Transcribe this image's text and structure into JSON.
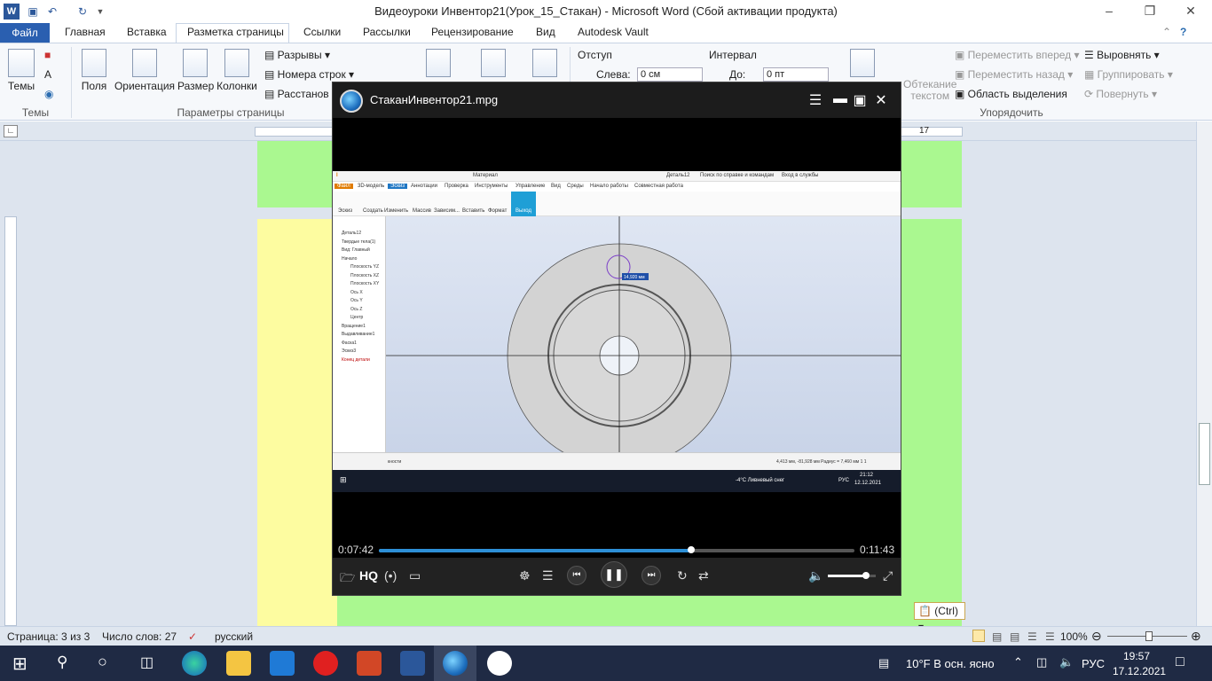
{
  "window": {
    "title": "Видеоуроки Инвентор21(Урок_15_Стакан)  -  Microsoft Word (Сбой активации продукта)"
  },
  "tabs": {
    "file": "Файл",
    "items": [
      "Главная",
      "Вставка",
      "Разметка страницы",
      "Ссылки",
      "Рассылки",
      "Рецензирование",
      "Вид",
      "Autodesk Vault"
    ]
  },
  "ribbon": {
    "themes": "Темы",
    "margins": "Поля",
    "orientation": "Ориентация",
    "size": "Размер",
    "columns": "Колонки",
    "breaks": "Разрывы",
    "line_numbers": "Номера строк",
    "hyphenation": "Расстанов",
    "group_themes": "Темы",
    "group_page_setup": "Параметры страницы",
    "indent_label": "Отступ",
    "indent_left_label": "Слева:",
    "indent_left_value": "0 см",
    "spacing_label": "Интервал",
    "spacing_after_label": "До:",
    "spacing_after_value": "0 пт",
    "wrap_text": "Обтекание",
    "wrap_text2": "текстом",
    "bring_forward": "Переместить вперед",
    "send_backward": "Переместить назад",
    "selection_pane": "Область выделения",
    "align": "Выровнять",
    "group": "Группировать",
    "rotate": "Повернуть",
    "group_arrange": "Упорядочить"
  },
  "ruler": {
    "right_mark": "17"
  },
  "player": {
    "filename": "СтаканИнвентор21.mpg",
    "time_elapsed": "0:07:42",
    "time_total": "0:11:43",
    "progress": 0.657,
    "volume": 0.8,
    "hq": "HQ"
  },
  "inventor": {
    "title": "Деталь12",
    "search": "Поиск по справке и командам",
    "signin": "Вход в службы",
    "material": "Материал",
    "tabs": [
      "Файл",
      "3D-модель",
      "Эскиз",
      "Аннотации",
      "Проверка",
      "Инструменты",
      "Управление",
      "Вид",
      "Среды",
      "Начало работы",
      "Совместная работа"
    ],
    "tools": [
      "Эскиз",
      "Создать",
      "Изменить",
      "Массив",
      "Зависим...",
      "Вставить",
      "Формат",
      "Выход"
    ],
    "tree": [
      "Деталь12",
      "Твердые тела(1)",
      "Вид: Главный",
      "Начало",
      "Плоскость YZ",
      "Плоскость XZ",
      "Плоскость XY",
      "Ось X",
      "Ось Y",
      "Ось Z",
      "Центр",
      "Вращение1",
      "Выдавливание1",
      "Фаска1",
      "Эскиз3",
      "Конец детали"
    ],
    "dimension": "14,920 мм",
    "status_left": "кности",
    "status_right": "4,413 мм, -81,928 мм  Радиус = 7,460 мм   1    1",
    "weather": "-4°C  Ливневый снег",
    "lang": "РУС",
    "time": "21:12",
    "date": "12.12.2021"
  },
  "paste_options": "(Ctrl)",
  "status": {
    "page": "Страница: 3 из 3",
    "words": "Число слов: 27",
    "language": "русский",
    "zoom": "100%"
  },
  "taskbar": {
    "weather": "10°F  В осн. ясно",
    "lang": "РУС",
    "time": "19:57",
    "date": "17.12.2021"
  }
}
